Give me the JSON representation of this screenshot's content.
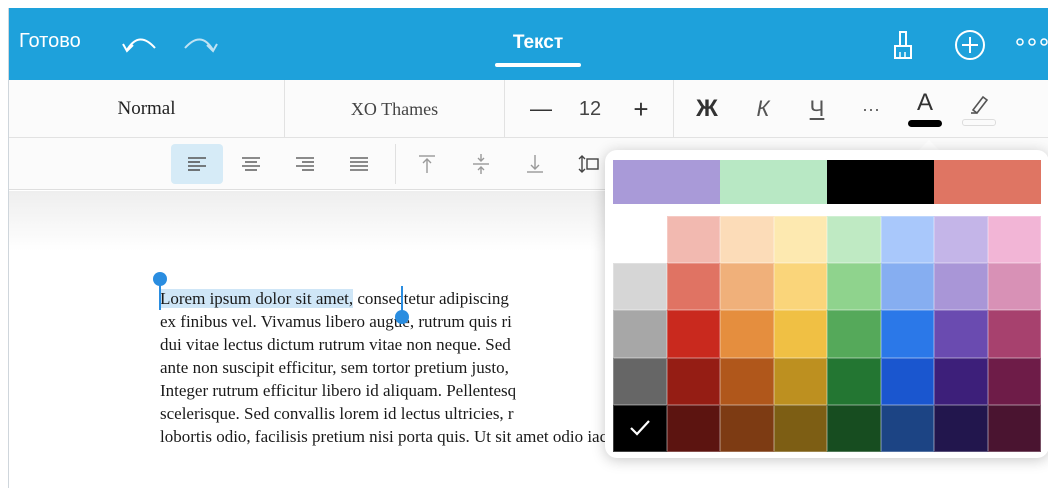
{
  "topbar": {
    "done_label": "Готово",
    "title": "Текст",
    "bg_color": "#1ea1db",
    "icons": {
      "undo": "undo-icon",
      "redo": "redo-icon",
      "brush": "brush-icon",
      "add": "plus-circle-icon",
      "more": "more-dots-icon"
    }
  },
  "toolbar1": {
    "style_name": "Normal",
    "font_name": "XO Thames",
    "decrease_label": "—",
    "font_size": "12",
    "increase_label": "+",
    "bold_label": "Ж",
    "italic_label": "К",
    "underline_label": "Ч",
    "more_label": "···",
    "font_color_label": "A",
    "font_color_value": "#000000",
    "highlight_icon": "highlighter-icon"
  },
  "toolbar2": {
    "active": "align-left",
    "items": [
      "align-left",
      "align-center",
      "align-right",
      "align-justify",
      "valign-top",
      "valign-middle",
      "valign-bottom",
      "line-spacing"
    ]
  },
  "document": {
    "selected_text": "Lorem ipsum dolor sit amet,",
    "lines": [
      " consectetur adipiscing",
      "ex finibus vel. Vivamus libero augue, rutrum quis ri",
      "dui vitae lectus dictum rutrum vitae non neque. Sed",
      "ante non suscipit efficitur, sem tortor pretium justo,",
      "Integer rutrum efficitur libero id aliquam. Pellentesq",
      "scelerisque. Sed convallis lorem id lectus ultricies, r",
      "lobortis odio, facilisis pretium nisi porta quis. Ut sit amet odio iaculis felis blandit condimentum."
    ]
  },
  "color_picker": {
    "recent_colors": [
      "#a99ad8",
      "#b8e8c4",
      "#000000",
      "#df7563"
    ],
    "selected": "#000000",
    "grid": [
      [
        "#ffffff",
        "#f2b9b0",
        "#fcdcb8",
        "#fde9b0",
        "#bfeac3",
        "#a9c8fb",
        "#c4b5e8",
        "#f2b5d6"
      ],
      [
        "#d6d6d6",
        "#e07363",
        "#f0b07a",
        "#fad57a",
        "#8fd38d",
        "#86aef1",
        "#a996d7",
        "#d891b6"
      ],
      [
        "#a7a7a7",
        "#c9291e",
        "#e58e3e",
        "#f0c044",
        "#55a95a",
        "#2b78e8",
        "#6a4bb0",
        "#a7416e"
      ],
      [
        "#666666",
        "#951d14",
        "#b0571b",
        "#bd9020",
        "#237632",
        "#1a56cf",
        "#3d1f7a",
        "#6e1c48"
      ],
      [
        "#000000",
        "#5c1410",
        "#7d3b13",
        "#7d5e14",
        "#174d20",
        "#1c4484",
        "#22164d",
        "#4a1430"
      ]
    ]
  }
}
